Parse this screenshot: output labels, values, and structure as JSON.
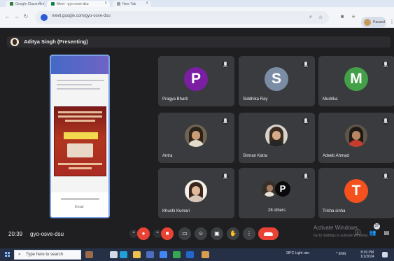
{
  "browser": {
    "tabs": [
      "Google Classroom",
      "Meet - gyo-osve-dsu",
      "New Tab"
    ],
    "url": "meet.google.com/gyo-osve-dsu",
    "profile_label": "Paused"
  },
  "meet": {
    "presenter_label": "Aditya Singh (Presenting)",
    "shared_screen": {
      "page_bottom_label": "Email"
    },
    "participants": [
      {
        "name": "Pragya Bharti",
        "initial": "P",
        "color": "#7b1fa2"
      },
      {
        "name": "Siddhika Ray",
        "initial": "S",
        "color": "#7b8da5"
      },
      {
        "name": "Mudrika",
        "initial": "M",
        "color": "#43a047"
      },
      {
        "name": "Antra",
        "initial": "",
        "color": ""
      },
      {
        "name": "Simran Katra",
        "initial": "",
        "color": ""
      },
      {
        "name": "Adeeb Ahmad",
        "initial": "",
        "color": ""
      },
      {
        "name": "Khushi Kumari",
        "initial": "",
        "color": ""
      },
      {
        "name": "28 others",
        "initial": "P",
        "color": ""
      },
      {
        "name": "Trisha sinha",
        "initial": "T",
        "color": "#f4511e"
      }
    ],
    "time": "20:39",
    "meeting_code": "gyo-osve-dsu",
    "participant_badge": "37",
    "activate_windows": "Activate Windows",
    "activate_settings": "Go to Settings to activate Windows."
  },
  "taskbar": {
    "search_placeholder": "Type here to search",
    "weather": "28°C  Light rain",
    "system_tray": "^  ENG",
    "time": "8:39 PM",
    "date": "1/1/2024"
  },
  "icons": {
    "back": "arrow-left",
    "forward": "arrow-right",
    "reload": "refresh",
    "mic": "mic",
    "camera": "camera",
    "present": "present",
    "raise_hand": "hand"
  },
  "colors": {
    "meet_background": "#1f1f22",
    "tile_background": "#3a3b3f",
    "danger": "#ea4335",
    "taskbar": "#253047"
  }
}
